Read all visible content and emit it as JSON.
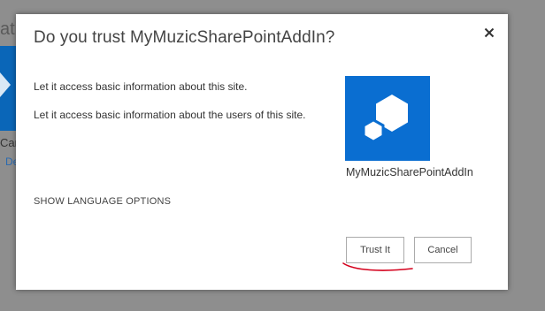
{
  "background": {
    "fragment_text": "atio",
    "tile_label": "Car",
    "tile_link": "De"
  },
  "dialog": {
    "title": "Do you trust MyMuzicSharePointAddIn?",
    "close_icon": "close-icon",
    "permissions": [
      "Let it access basic information about this site.",
      "Let it access basic information about the users of this site."
    ],
    "app_name": "MyMuzicSharePointAddIn",
    "app_icon": "app-hexagons-icon",
    "show_language_options": "SHOW LANGUAGE OPTIONS",
    "buttons": {
      "trust": "Trust It",
      "cancel": "Cancel"
    }
  },
  "colors": {
    "tile_blue": "#0a6ed1",
    "annotation_red": "#d4001c",
    "overlay_gray": "#8e8e8e"
  }
}
